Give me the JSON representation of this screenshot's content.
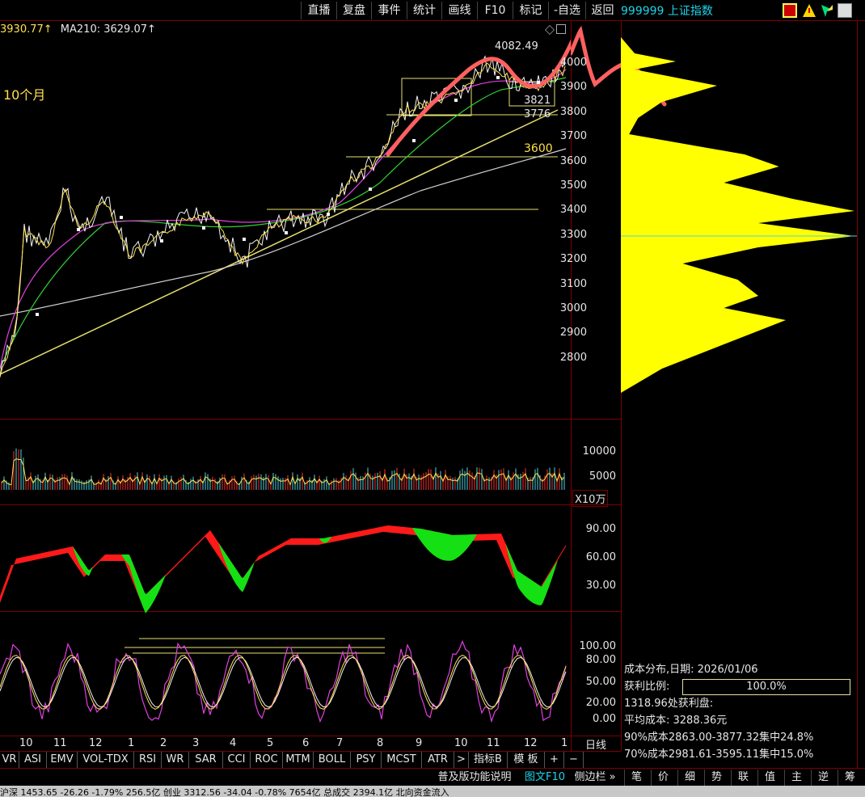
{
  "toolbar": {
    "buttons": [
      "直播",
      "复盘",
      "事件",
      "统计",
      "画线",
      "F10",
      "标记",
      "-自选",
      "返回"
    ],
    "index_name": "999999 上证指数"
  },
  "ma_line": {
    "ma_a": "3930.77↑",
    "ma_b": "MA210: 3629.07↑"
  },
  "annotations": {
    "note": "10个月",
    "high_label": "4082.49",
    "box_label": "3821",
    "level_3776": "3776",
    "level_3600": "3600"
  },
  "price_axis": [
    "4000",
    "3900",
    "3800",
    "3700",
    "3600",
    "3500",
    "3400",
    "3300",
    "3200",
    "3100",
    "3000",
    "2900",
    "2800"
  ],
  "volume_axis": [
    "10000",
    "5000"
  ],
  "volume_unit": "X10万",
  "osc1_axis": [
    "90.00",
    "60.00",
    "30.00"
  ],
  "osc2_axis": [
    "100.00",
    "80.00",
    "50.00",
    "20.00",
    "0.00"
  ],
  "months": [
    "10",
    "11",
    "12",
    "1",
    "2",
    "3",
    "4",
    "5",
    "6",
    "7",
    "8",
    "9",
    "10",
    "11",
    "12",
    "1"
  ],
  "period_label": "日线",
  "indicator_tabs": [
    "VR",
    "ASI",
    "EMV",
    "VOL-TDX",
    "RSI",
    "WR",
    "SAR",
    "CCI",
    "ROC",
    "MTM",
    "BOLL",
    "PSY",
    "MCST",
    "ATR",
    ">",
    "指标B",
    "模 板",
    "+",
    "−"
  ],
  "bottom_bar": {
    "help": "普及版功能说明",
    "f10": "图文F10",
    "sidebar": "侧边栏 »",
    "buttons": [
      "笔",
      "价",
      "细",
      "势",
      "联",
      "值",
      "主",
      "逆",
      "筹"
    ]
  },
  "cost": {
    "title": "成本分布,日期: 2026/01/06",
    "profit_label": "获利比例:",
    "profit_value": "100.0%",
    "profit_line": "1318.96处获利盘:",
    "avg_cost": "平均成本: 3288.36元",
    "c90": "90%成本2863.00-3877.32集中24.8%",
    "c70": "70%成本2981.61-3595.11集中15.0%"
  },
  "status_text": "沪深 1453.65 -26.26 -1.79%  256.5亿   创业 3312.56 -34.04 -0.78%  7654亿   总成交 2394.1亿  北向资金流入"
}
